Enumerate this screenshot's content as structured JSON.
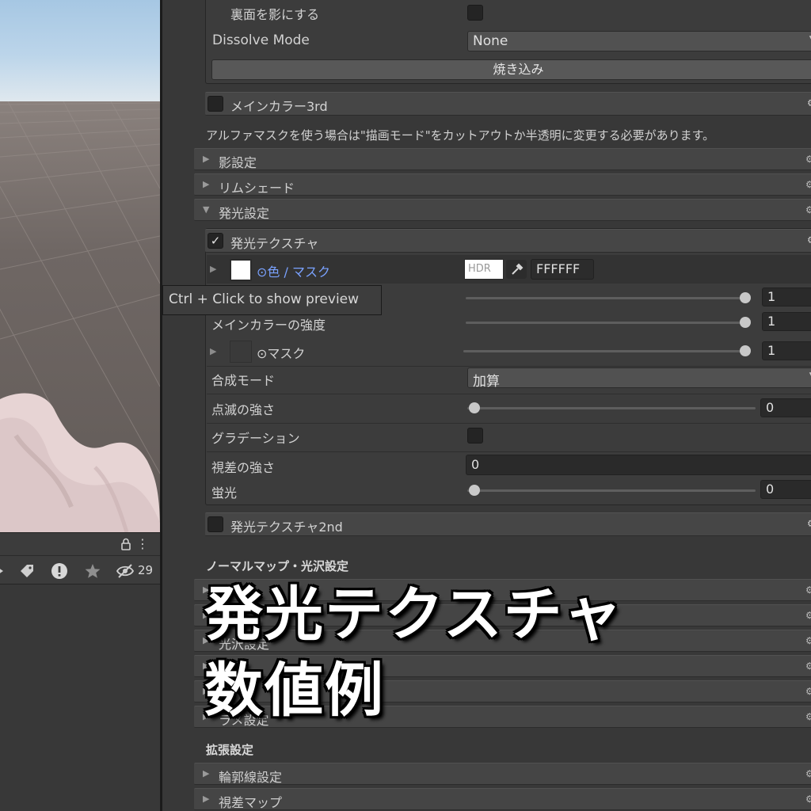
{
  "scene": {
    "hidden_count": "29",
    "icons": [
      "lock-icon",
      "kebab-menu-icon",
      "shape-icon",
      "tag-icon",
      "warning-icon",
      "star-icon",
      "eye-off-icon"
    ]
  },
  "tooltip": "Ctrl + Click to show preview",
  "inspector": {
    "backface_shadow_label": "裏面を影にする",
    "dissolve_mode_label": "Dissolve Mode",
    "dissolve_mode_value": "None",
    "bake_button": "焼き込み",
    "main_color_3rd": "メインカラー3rd",
    "alpha_mask_note": "アルファマスクを使う場合は\"描画モード\"をカットアウトか半透明に変更する必要があります。",
    "foldouts_top": [
      "影設定",
      "リムシェード",
      "発光設定"
    ],
    "emission_texture": {
      "header": "発光テクスチャ",
      "color_mask_label": "⊙色 / マスク",
      "hdr_label": "HDR",
      "color_hex": "FFFFFF",
      "main_color_strength_label": "メインカラーの強度",
      "mask_label": "⊙マスク",
      "blend_mode_label": "合成モード",
      "blend_mode_value": "加算",
      "blink_strength_label": "点滅の強さ",
      "gradation_label": "グラデーション",
      "parallax_strength_label": "視差の強さ",
      "fluorescence_label": "蛍光",
      "values": {
        "hidden_row": "1",
        "main_color_strength": "1",
        "mask": "1",
        "blink_strength": "0",
        "parallax_strength": "0",
        "fluorescence": "0"
      },
      "slider_levels": {
        "hidden_row": 1,
        "main_color_strength": 1,
        "mask": 1,
        "blink_strength": 0,
        "fluorescence": 0
      }
    },
    "emission_texture_2nd": "発光テクスチャ2nd",
    "normal_map_section": "ノーマルマップ・光沢設定",
    "foldouts_middle": [
      "",
      "",
      "光沢設定",
      "",
      "",
      "ラメ設定"
    ],
    "extended_section": "拡張設定",
    "foldouts_bottom": [
      "輪郭線設定",
      "視差マップ"
    ]
  },
  "overlay": {
    "line1": "発光テクスチャ",
    "line2": "数値例"
  },
  "colors": {
    "panel_bg": "#383838",
    "field_bg": "#2a2a2a",
    "link_blue": "#7aa2ff",
    "text": "#d2d2d2"
  }
}
